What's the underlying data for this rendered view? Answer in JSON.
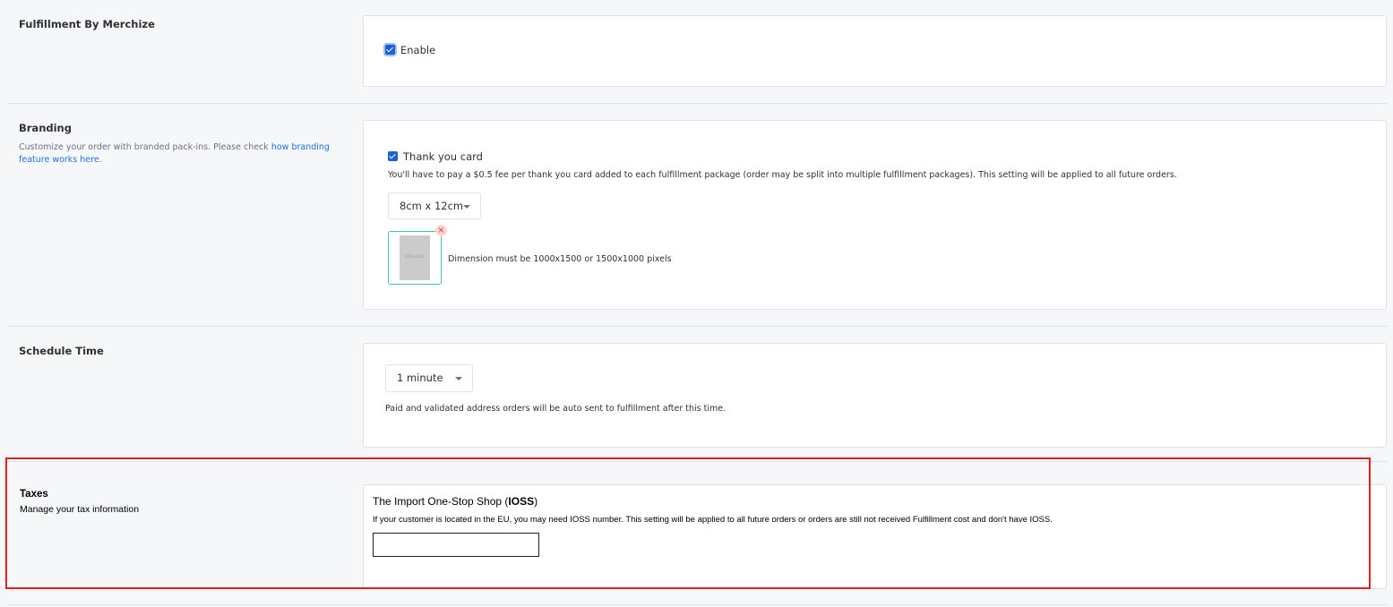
{
  "fulfillment": {
    "title": "Fulfillment By Merchize",
    "enable_label": "Enable",
    "enabled": true
  },
  "branding": {
    "title": "Branding",
    "description": "Customize your order with branded pack-ins. Please check ",
    "link_text": "how branding feature works here.",
    "thank_you_label": "Thank you card",
    "thank_you_checked": true,
    "fee_note": "You'll have to pay a $0.5 fee per thank you card added to each fulfillment package (order may be split into multiple fulfillment packages). This setting will be applied to all future orders.",
    "size_selected": "8cm x 12cm",
    "dimension_note": "Dimension must be 1000x1500 or 1500x1000 pixels",
    "thumb_text": "1000x1500",
    "remove_glyph": "×"
  },
  "schedule": {
    "title": "Schedule Time",
    "selected": "1 minute",
    "note": "Paid and validated address orders will be auto sent to fulfillment after this time."
  },
  "taxes": {
    "title": "Taxes",
    "subtitle": "Manage your tax information",
    "ioss_prefix": "The Import One-Stop Shop (",
    "ioss_bold": "IOSS",
    "ioss_suffix": ")",
    "note": "If your customer is located in the EU, you may need IOSS number. This setting will be applied to all future orders or orders are still not received Fulfillment cost and don't have IOSS.",
    "input_value": ""
  },
  "icons": {
    "checkbox": "checkbox-checked-icon",
    "caret": "caret-down-icon",
    "remove": "close-icon"
  },
  "colors": {
    "accent": "#1b5fd9",
    "link": "#1a73e8",
    "highlight": "#e02020",
    "upload_border": "#3ecf8e"
  }
}
